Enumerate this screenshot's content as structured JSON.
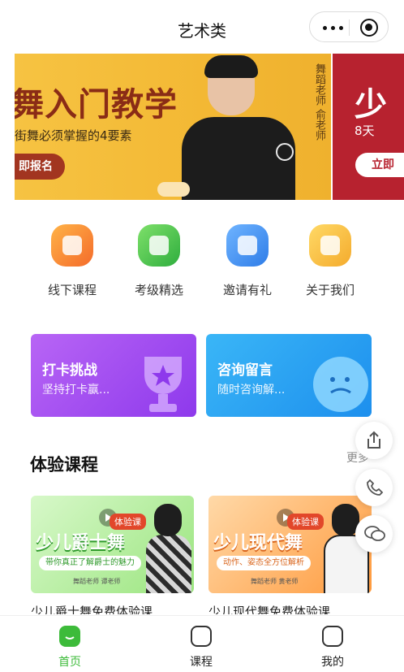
{
  "header": {
    "title": "艺术类",
    "more_icon": "more-dots-icon",
    "close_icon": "target-icon"
  },
  "banner": {
    "headline": "舞入门教学",
    "subtitle": "街舞必须掌握的4要素",
    "cta": "即报名",
    "teacher_label": "舞蹈老师 俞老师"
  },
  "banner_next": {
    "headline": "少",
    "subtitle": "8天",
    "cta": "立即"
  },
  "nav": [
    {
      "label": "线下课程",
      "icon": "book-icon",
      "color": "#f47a2b"
    },
    {
      "label": "考级精选",
      "icon": "star-icon",
      "color": "#39b54a"
    },
    {
      "label": "邀请有礼",
      "icon": "bell-icon",
      "color": "#3a8df0"
    },
    {
      "label": "关于我们",
      "icon": "chat-icon",
      "color": "#f4b72d"
    }
  ],
  "cards": [
    {
      "title": "打卡挑战",
      "subtitle": "坚持打卡赢...",
      "color": "#a34ff0"
    },
    {
      "title": "咨询留言",
      "subtitle": "随时咨询解...",
      "color": "#2aa6f4"
    }
  ],
  "section": {
    "title": "体验课程",
    "more": "更多"
  },
  "courses": [
    {
      "tag": "体验课",
      "title": "少儿爵士舞",
      "strip": "带你真正了解爵士的魅力",
      "teacher": "舞蹈老师 谭老师",
      "name": "少儿爵士舞免费体验课"
    },
    {
      "tag": "体验课",
      "title": "少儿现代舞",
      "strip": "动作、姿态全方位解析",
      "teacher": "舞蹈老师 黄老师",
      "name": "少儿现代舞免费体验课"
    }
  ],
  "floating": [
    {
      "icon": "share-icon"
    },
    {
      "icon": "phone-icon"
    },
    {
      "icon": "wechat-icon"
    }
  ],
  "tabbar": [
    {
      "label": "首页",
      "icon": "home-icon",
      "active": true
    },
    {
      "label": "课程",
      "icon": "tv-icon",
      "active": false
    },
    {
      "label": "我的",
      "icon": "user-icon",
      "active": false
    }
  ]
}
